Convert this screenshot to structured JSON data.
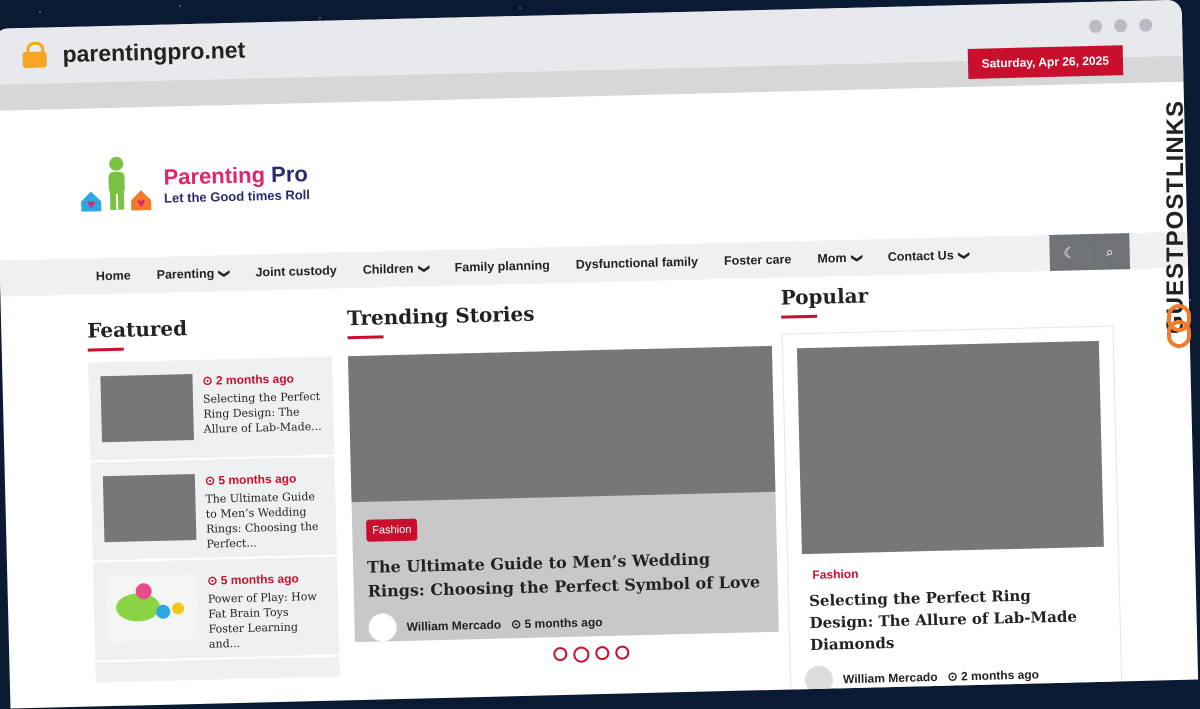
{
  "browser": {
    "url": "parentingpro.net"
  },
  "topbar": {
    "date": "Saturday, Apr 26, 2025"
  },
  "logo": {
    "name_a": "Parenting",
    "name_b": "Pro",
    "tagline": "Let the Good times Roll"
  },
  "nav": {
    "items": [
      {
        "label": "Home",
        "dropdown": false
      },
      {
        "label": "Parenting",
        "dropdown": true
      },
      {
        "label": "Joint custody",
        "dropdown": false
      },
      {
        "label": "Children",
        "dropdown": true
      },
      {
        "label": "Family planning",
        "dropdown": false
      },
      {
        "label": "Dysfunctional family",
        "dropdown": false
      },
      {
        "label": "Foster care",
        "dropdown": false
      },
      {
        "label": "Mom",
        "dropdown": true
      },
      {
        "label": "Contact Us",
        "dropdown": true
      }
    ],
    "chevron": "❯",
    "dark_mode_icon": "☾",
    "search_icon": "⌕"
  },
  "featured": {
    "heading": "Featured",
    "items": [
      {
        "time": "2 months ago",
        "title": "Selecting the Perfect Ring Design: The Allure of Lab-Made..."
      },
      {
        "time": "5 months ago",
        "title": "The Ultimate Guide to Men’s Wedding Rings: Choosing the Perfect..."
      },
      {
        "time": "5 months ago",
        "title": "Power of Play: How Fat Brain Toys Foster Learning and..."
      }
    ]
  },
  "trending": {
    "heading": "Trending Stories",
    "tag": "Fashion",
    "title": "The Ultimate Guide to Men’s Wedding Rings: Choosing the Perfect Symbol of Love",
    "author": "William Mercado",
    "time": "5 months ago"
  },
  "popular": {
    "heading": "Popular",
    "category": "Fashion",
    "title": "Selecting the Perfect Ring Design: The Allure of Lab-Made Diamonds",
    "author": "William Mercado",
    "time": "2 months ago"
  },
  "watermark": {
    "text": "GUESTPOSTLINKS"
  },
  "colors": {
    "accent": "#c8102e",
    "nav_bg": "#f0f0f2",
    "placeholder": "#777777"
  }
}
